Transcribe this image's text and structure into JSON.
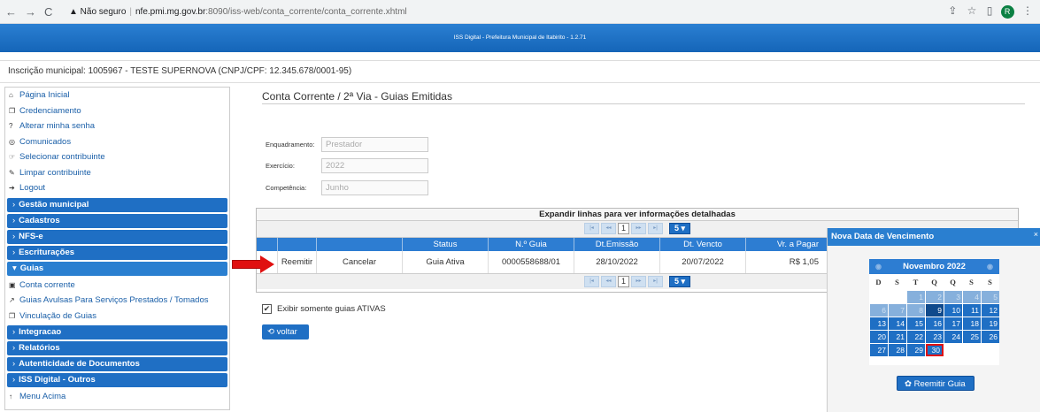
{
  "browser": {
    "back": "←",
    "forward": "→",
    "reload": "C",
    "security": "▲ Não seguro",
    "host": "nfe.pmi.mg.gov.br",
    "path": ":8090/iss-web/conta_corrente/conta_corrente.xhtml",
    "avatar": "R"
  },
  "app_title": "ISS Digital - Prefeitura Municipal de Itabirito - 1.2.71",
  "inscricao": "Inscrição municipal: 1005967 - TESTE SUPERNOVA (CNPJ/CPF: 12.345.678/0001-95)",
  "sidebar": {
    "links_top": [
      {
        "icon": "home-icon",
        "label": "Página Inicial",
        "glyph": "⌂"
      },
      {
        "icon": "copy-icon",
        "label": "Credenciamento",
        "glyph": "❐"
      },
      {
        "icon": "question-icon",
        "label": "Alterar minha senha",
        "glyph": "?"
      },
      {
        "icon": "comment-icon",
        "label": "Comunicados",
        "glyph": "◎"
      },
      {
        "icon": "hand-icon",
        "label": "Selecionar contribuinte",
        "glyph": "☞"
      },
      {
        "icon": "eraser-icon",
        "label": "Limpar contribuinte",
        "glyph": "✎"
      },
      {
        "icon": "logout-icon",
        "label": "Logout",
        "glyph": "➔"
      }
    ],
    "sections_a": [
      "Gestão municipal",
      "Cadastros",
      "NFS-e",
      "Escriturações"
    ],
    "open_section": "Guias",
    "sub_links": [
      {
        "icon": "money-icon",
        "label": "Conta corrente",
        "glyph": "▣"
      },
      {
        "icon": "external-link-icon",
        "label": "Guias Avulsas Para Serviços Prestados / Tomados",
        "glyph": "↗"
      },
      {
        "icon": "copy-icon",
        "label": "Vinculação de Guias",
        "glyph": "❐"
      }
    ],
    "sections_b": [
      "Integracao",
      "Relatórios",
      "Autenticidade de Documentos",
      "ISS Digital - Outros"
    ],
    "footer": "Menu Acima"
  },
  "page_title": "Conta Corrente / 2ª Via - Guias Emitidas",
  "form": {
    "enquadramento_label": "Enquadramento:",
    "enquadramento_value": "Prestador",
    "exercicio_label": "Exercício:",
    "exercicio_value": "2022",
    "competencia_label": "Competência:",
    "competencia_value": "Junho"
  },
  "grid": {
    "caption": "Expandir linhas para ver informações detalhadas",
    "page": "1",
    "rows_per_page": "5 ▾",
    "headers": [
      "",
      "",
      "",
      "Status",
      "N.º Guia",
      "Dt.Emissão",
      "Dt. Vencto",
      "Vr. a Pagar"
    ],
    "row": [
      "",
      "Reemitir",
      "Cancelar",
      "Guia Ativa",
      "0000558688/01",
      "28/10/2022",
      "20/07/2022",
      "R$ 1,05"
    ]
  },
  "checkbox_label": "Exibir somente guias ATIVAS",
  "voltar": "⟲ voltar",
  "dialog": {
    "title": "Nova Data de Vencimento",
    "close": "×",
    "month": "Novembro 2022",
    "dow": [
      "D",
      "S",
      "T",
      "Q",
      "Q",
      "S",
      "S"
    ],
    "selected_day": 30,
    "button": "✿ Reemitir Guia"
  },
  "colors": {
    "primary": "#1f6fc4",
    "arrow": "#e01010"
  }
}
